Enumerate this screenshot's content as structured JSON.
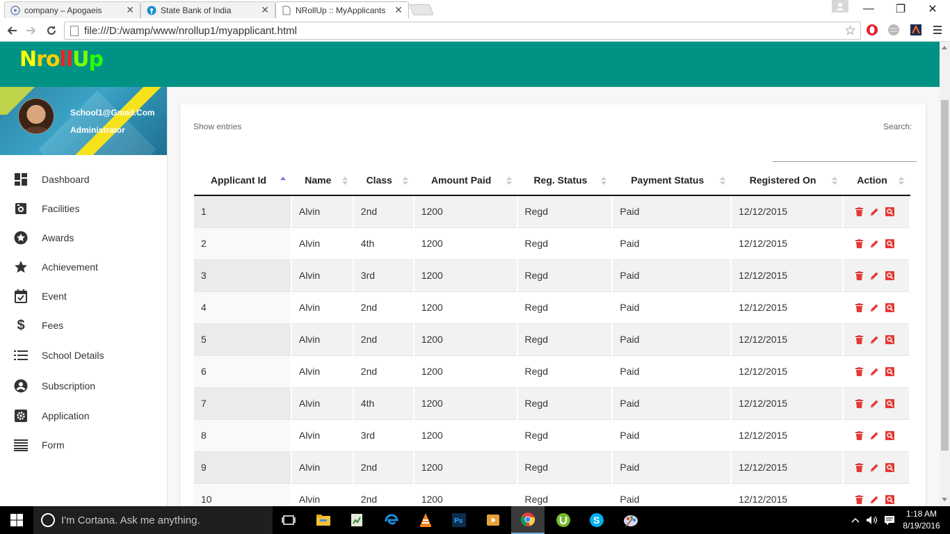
{
  "browser": {
    "tabs": [
      {
        "label": "company – Apogaeis",
        "active": false
      },
      {
        "label": "State Bank of India",
        "active": false
      },
      {
        "label": "NRollUp :: MyApplicants",
        "active": true
      }
    ],
    "url": "file:///D:/wamp/www/nrollup1/myapplicant.html"
  },
  "app": {
    "logo": {
      "n": "N",
      "ro": "ro",
      "ll": "ll",
      "u": "U",
      "p": "p"
    }
  },
  "sidebar": {
    "email": "School1@Gmail.Com",
    "role": "Administrator",
    "items": [
      {
        "label": "Dashboard",
        "icon": "dashboard-icon"
      },
      {
        "label": "Facilities",
        "icon": "facilities-icon"
      },
      {
        "label": "Awards",
        "icon": "star-circle-icon"
      },
      {
        "label": "Achievement",
        "icon": "star-icon"
      },
      {
        "label": "Event",
        "icon": "calendar-check-icon"
      },
      {
        "label": "Fees",
        "icon": "dollar-icon"
      },
      {
        "label": "School Details",
        "icon": "list-icon"
      },
      {
        "label": "Subscription",
        "icon": "account-circle-icon"
      },
      {
        "label": "Application",
        "icon": "settings-box-icon"
      },
      {
        "label": "Form",
        "icon": "lines-icon"
      }
    ]
  },
  "table": {
    "show_entries": "Show entries",
    "search_label": "Search:",
    "search_value": "",
    "headers": [
      "Applicant Id",
      "Name",
      "Class",
      "Amount Paid",
      "Reg. Status",
      "Payment Status",
      "Registered On",
      "Action"
    ],
    "sorted_column": "Applicant Id",
    "rows": [
      [
        "1",
        "Alvin",
        "2nd",
        "1200",
        "Regd",
        "Paid",
        "12/12/2015"
      ],
      [
        "2",
        "Alvin",
        "4th",
        "1200",
        "Regd",
        "Paid",
        "12/12/2015"
      ],
      [
        "3",
        "Alvin",
        "3rd",
        "1200",
        "Regd",
        "Paid",
        "12/12/2015"
      ],
      [
        "4",
        "Alvin",
        "2nd",
        "1200",
        "Regd",
        "Paid",
        "12/12/2015"
      ],
      [
        "5",
        "Alvin",
        "2nd",
        "1200",
        "Regd",
        "Paid",
        "12/12/2015"
      ],
      [
        "6",
        "Alvin",
        "2nd",
        "1200",
        "Regd",
        "Paid",
        "12/12/2015"
      ],
      [
        "7",
        "Alvin",
        "4th",
        "1200",
        "Regd",
        "Paid",
        "12/12/2015"
      ],
      [
        "8",
        "Alvin",
        "3rd",
        "1200",
        "Regd",
        "Paid",
        "12/12/2015"
      ],
      [
        "9",
        "Alvin",
        "2nd",
        "1200",
        "Regd",
        "Paid",
        "12/12/2015"
      ],
      [
        "10",
        "Alvin",
        "2nd",
        "1200",
        "Regd",
        "Paid",
        "12/12/2015"
      ]
    ],
    "action_icons": [
      "delete-icon",
      "edit-icon",
      "view-icon"
    ]
  },
  "taskbar": {
    "cortana_placeholder": "I'm Cortana. Ask me anything.",
    "time": "1:18 AM",
    "date": "8/19/2016"
  },
  "colors": {
    "header": "#009385",
    "action": "#e53935",
    "sort_active": "#7b7fd6"
  }
}
